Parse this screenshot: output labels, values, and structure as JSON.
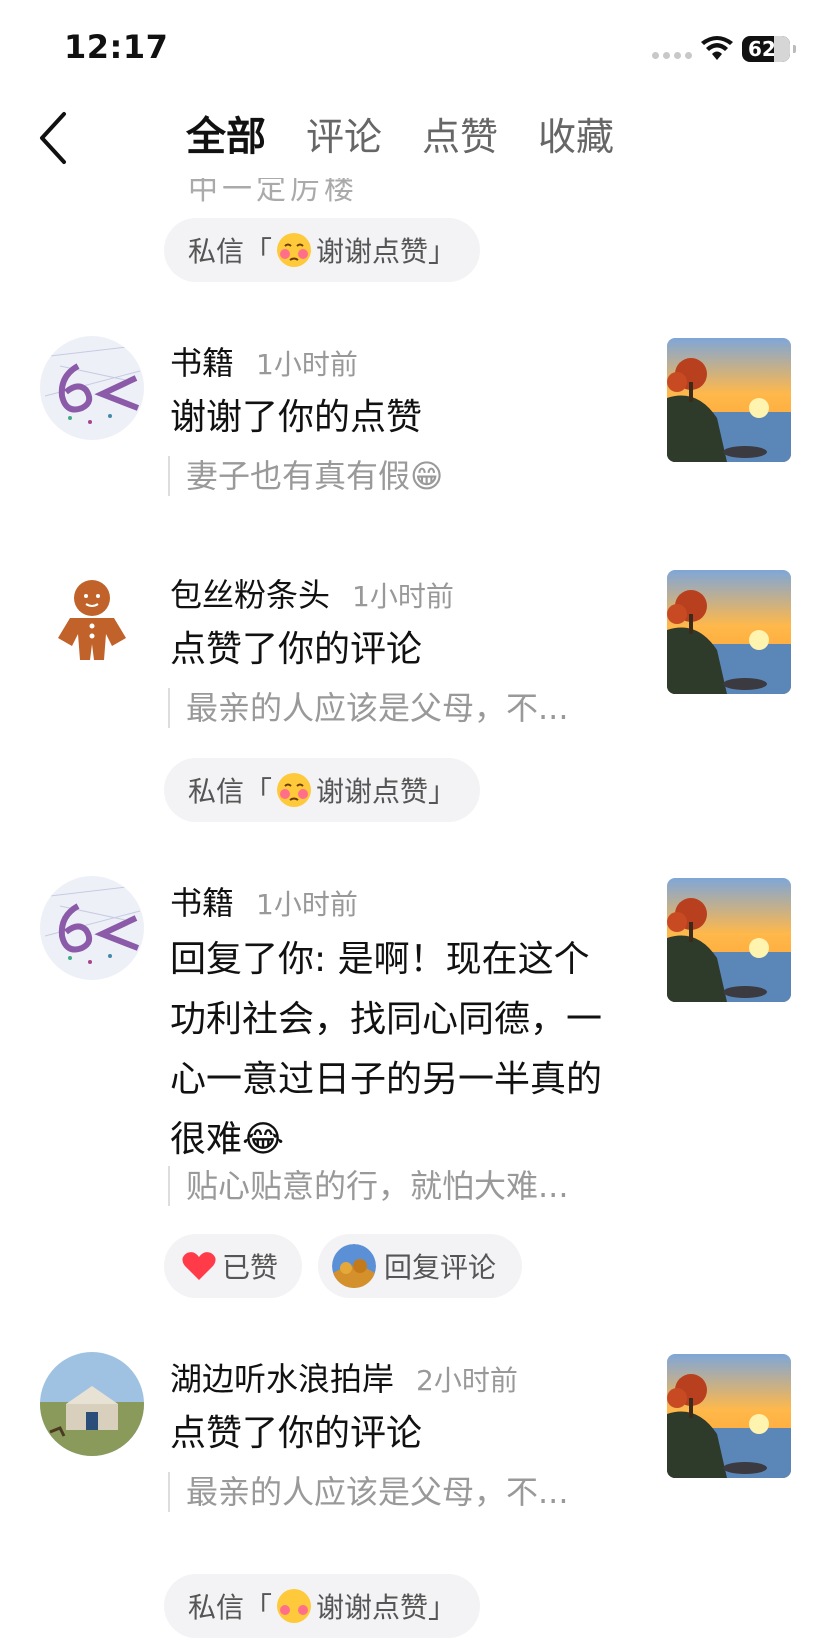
{
  "status": {
    "time": "12:17",
    "battery": "62"
  },
  "nav": {
    "tabs": [
      "全部",
      "评论",
      "点赞",
      "收藏"
    ]
  },
  "top_cut": {
    "text": "中一定厉楼"
  },
  "dm_pill": {
    "prefix": "私信「",
    "label": "谢谢点赞」"
  },
  "items": [
    {
      "username": "书籍",
      "time": "1小时前",
      "action": "谢谢了你的点赞",
      "quote": "妻子也有真有假😁"
    },
    {
      "username": "包丝粉条头",
      "time": "1小时前",
      "action": "点赞了你的评论",
      "quote": "最亲的人应该是父母，不..."
    },
    {
      "username": "书籍",
      "time": "1小时前",
      "action": "回复了你: 是啊！现在这个功利社会，找同心同德，一心一意过日子的另一半真的很难😂",
      "quote": "贴心贴意的行，就怕大难..."
    },
    {
      "username": "湖边听水浪拍岸",
      "time": "2小时前",
      "action": "点赞了你的评论",
      "quote": "最亲的人应该是父母，不..."
    }
  ],
  "reply_actions": {
    "liked": "已赞",
    "reply": "回复评论"
  },
  "icons": [
    "back-icon",
    "wifi-icon",
    "battery-icon",
    "heart-icon"
  ],
  "colors": {
    "heart": "#ff3b4a",
    "pill_bg": "#f3f3f5",
    "muted": "#999999"
  }
}
